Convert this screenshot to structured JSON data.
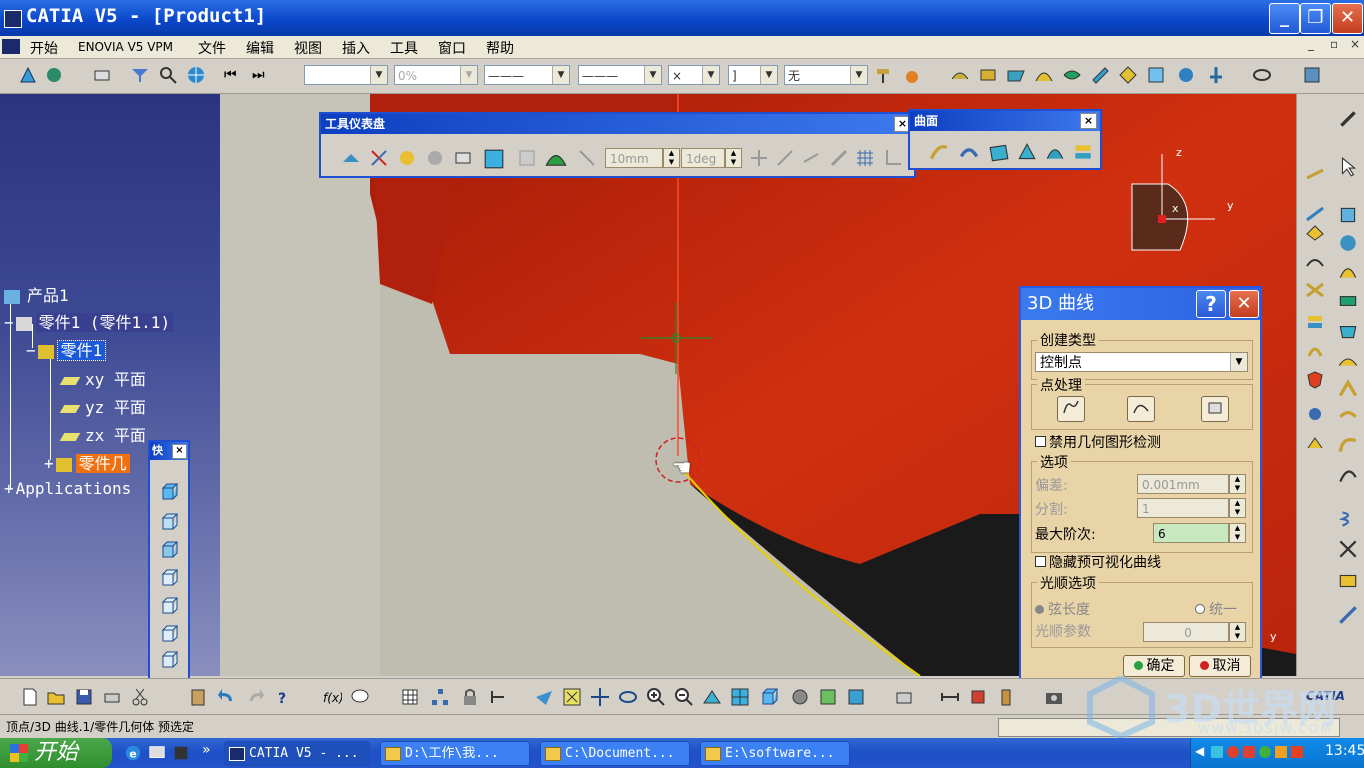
{
  "window": {
    "title": "CATIA V5 - [Product1]",
    "min": "_",
    "max": "❐",
    "close": "✕"
  },
  "menu": [
    "开始",
    "ENOVIA V5 VPM",
    "文件",
    "编辑",
    "视图",
    "插入",
    "工具",
    "窗口",
    "帮助"
  ],
  "mdi_controls": [
    "_",
    "▫",
    "×"
  ],
  "toolbar": {
    "layer_combo": "",
    "percent_combo": "0%",
    "linetype_combo": "———",
    "thickness_combo": "———",
    "point_combo": "×",
    "snap_combo": "]",
    "material_combo": "无"
  },
  "tree": {
    "root": "产品1",
    "part_instance": "零件1 (零件1.1)",
    "part": "零件1",
    "plane_xy": "xy 平面",
    "plane_yz": "yz 平面",
    "plane_zx": "zx 平面",
    "body": "零件几",
    "applications": "Applications"
  },
  "dashboard": {
    "title": "工具仪表盘",
    "close": "×",
    "step_value": "10mm",
    "angle_value": "1deg"
  },
  "surface_toolbar": {
    "title": "曲面",
    "close": "×"
  },
  "quick_toolbar": {
    "title": "快",
    "close": "×"
  },
  "compass": {
    "z": "z",
    "x": "x",
    "y": "y"
  },
  "axis_y": "y",
  "curve_dialog": {
    "title": "3D 曲线",
    "help": "?",
    "close": "✕",
    "create_type_label": "创建类型",
    "create_type_value": "控制点",
    "point_processing_label": "点处理",
    "disable_geometry_check": "禁用几何图形检测",
    "options_label": "选项",
    "deviation_label": "偏差:",
    "deviation_value": "0.001mm",
    "segmentation_label": "分割:",
    "segmentation_value": "1",
    "max_order_label": "最大阶次:",
    "max_order_value": "6",
    "hide_preview": "隐藏预可视化曲线",
    "smoothing_label": "光顺选项",
    "chord_length": "弦长度",
    "uniform": "统一",
    "smoothing_param_label": "光顺参数",
    "smoothing_param_value": "0",
    "ok": "确定",
    "cancel": "取消"
  },
  "status": {
    "text": "顶点/3D 曲线.1/零件几何体 预选定"
  },
  "taskbar": {
    "start": "开始",
    "tasks": [
      "CATIA V5 - ...",
      "D:\\工作\\我...",
      "C:\\Document...",
      "E:\\software..."
    ],
    "time": "13:45"
  },
  "watermark": {
    "brand": "3D世界网",
    "url": "WWW.3DSJW.COM"
  },
  "colors": {
    "titlebar": "#0a45c9",
    "tree_bg": "#2b3480",
    "model_red": "#c2260e",
    "curve_yellow": "#e8d000",
    "dialog_bg": "#e9d4a8",
    "selected": "#f07010"
  }
}
